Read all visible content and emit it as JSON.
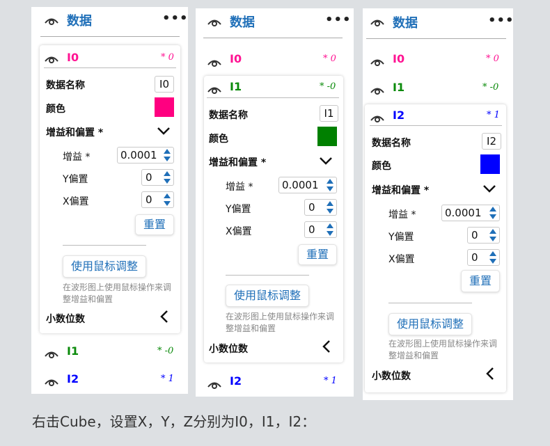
{
  "colors": {
    "title": "#1f6fb8",
    "i0": "#ff1493",
    "i1": "#0a8a0a",
    "i2": "#0000ff",
    "swatch_i0": "#ff0080",
    "swatch_i1": "#008000",
    "swatch_i2": "#0000ff"
  },
  "panel_title": "数据",
  "more_icon": "•••",
  "channels": [
    {
      "name": "I0",
      "value": "* 0"
    },
    {
      "name": "I1",
      "value": "* -0"
    },
    {
      "name": "I2",
      "value": "* 1"
    }
  ],
  "form": {
    "data_name_label": "数据名称",
    "color_label": "颜色",
    "gain_offset_label": "增益和偏置 *",
    "gain_label": "增益 *",
    "y_offset_label": "Y偏置",
    "x_offset_label": "X偏置",
    "gain_value": "0.0001",
    "y_offset_value": "0",
    "x_offset_value": "0",
    "reset_button": "重置",
    "mouse_button": "使用鼠标调整",
    "note": "在波形图上使用鼠标操作来调整增益和偏置",
    "decimal_label": "小数位数"
  },
  "caption": "右击Cube，设置X，Y，Z分别为I0，I1，I2："
}
